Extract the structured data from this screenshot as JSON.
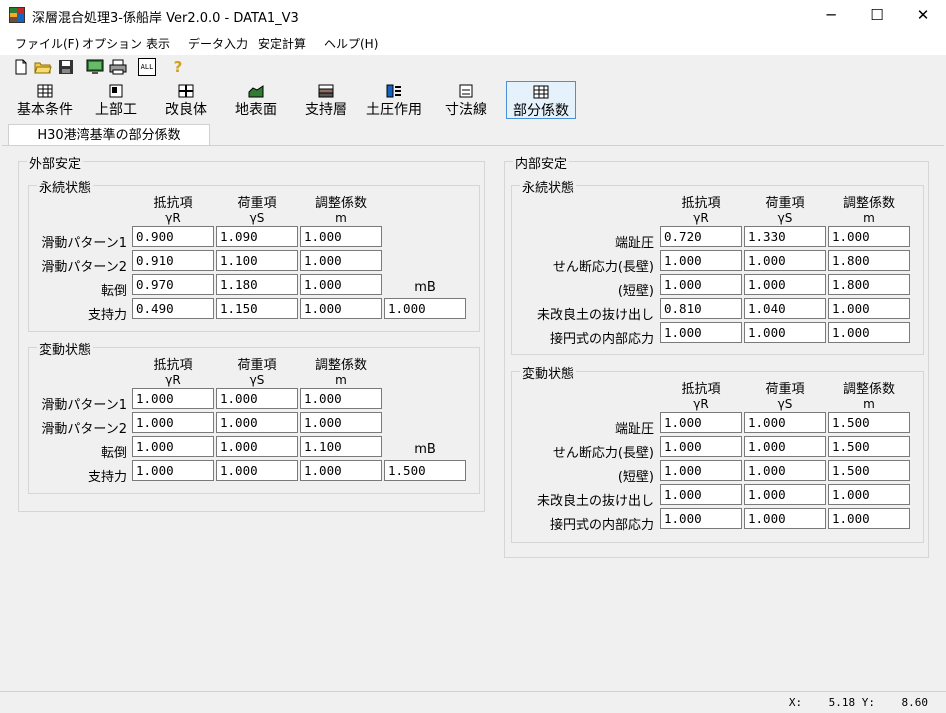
{
  "window": {
    "title": "深層混合処理3-係船岸 Ver2.0.0 - DATA1_V3",
    "minimize": "─",
    "maximize": "☐",
    "close": "✕"
  },
  "menu": [
    "ファイル(F)",
    "オプション",
    "表示",
    "データ入力",
    "安定計算",
    "ヘルプ(H)"
  ],
  "toolbar_icons": [
    "new-file-icon",
    "open-folder-icon",
    "save-icon",
    "monitor-icon",
    "print-icon",
    "all-icon",
    "help-icon"
  ],
  "toolbar_all_label": "ALL",
  "toolbar_help_glyph": "?",
  "nav_buttons": [
    {
      "label": "基本条件"
    },
    {
      "label": "上部工"
    },
    {
      "label": "改良体"
    },
    {
      "label": "地表面"
    },
    {
      "label": "支持層"
    },
    {
      "label": "土圧作用"
    },
    {
      "label": "寸法線"
    },
    {
      "label": "部分係数"
    }
  ],
  "tab": "H30港湾基準の部分係数",
  "external": {
    "title": "外部安定",
    "headers": [
      {
        "title": "抵抗項",
        "sub": "γR"
      },
      {
        "title": "荷重項",
        "sub": "γS"
      },
      {
        "title": "調整係数",
        "sub": "m"
      }
    ],
    "mb_label": "mB",
    "permanent": {
      "title": "永続状態",
      "rows": [
        {
          "label": "滑動パターン1",
          "values": [
            "0.900",
            "1.090",
            "1.000"
          ]
        },
        {
          "label": "滑動パターン2",
          "values": [
            "0.910",
            "1.100",
            "1.000"
          ]
        },
        {
          "label": "転倒",
          "values": [
            "0.970",
            "1.180",
            "1.000"
          ]
        },
        {
          "label": "支持力",
          "values": [
            "0.490",
            "1.150",
            "1.000"
          ],
          "mb": "1.000"
        }
      ]
    },
    "variable": {
      "title": "変動状態",
      "rows": [
        {
          "label": "滑動パターン1",
          "values": [
            "1.000",
            "1.000",
            "1.000"
          ]
        },
        {
          "label": "滑動パターン2",
          "values": [
            "1.000",
            "1.000",
            "1.000"
          ]
        },
        {
          "label": "転倒",
          "values": [
            "1.000",
            "1.000",
            "1.100"
          ]
        },
        {
          "label": "支持力",
          "values": [
            "1.000",
            "1.000",
            "1.000"
          ],
          "mb": "1.500"
        }
      ]
    }
  },
  "internal": {
    "title": "内部安定",
    "headers": [
      {
        "title": "抵抗項",
        "sub": "γR"
      },
      {
        "title": "荷重項",
        "sub": "γS"
      },
      {
        "title": "調整係数",
        "sub": "m"
      }
    ],
    "permanent": {
      "title": "永続状態",
      "rows": [
        {
          "label": "端趾圧",
          "values": [
            "0.720",
            "1.330",
            "1.000"
          ]
        },
        {
          "label": "せん断応力(長壁)",
          "values": [
            "1.000",
            "1.000",
            "1.800"
          ]
        },
        {
          "label": "(短壁)",
          "values": [
            "1.000",
            "1.000",
            "1.800"
          ]
        },
        {
          "label": "未改良土の抜け出し",
          "values": [
            "0.810",
            "1.040",
            "1.000"
          ]
        },
        {
          "label": "接円式の内部応力",
          "values": [
            "1.000",
            "1.000",
            "1.000"
          ]
        }
      ]
    },
    "variable": {
      "title": "変動状態",
      "rows": [
        {
          "label": "端趾圧",
          "values": [
            "1.000",
            "1.000",
            "1.500"
          ]
        },
        {
          "label": "せん断応力(長壁)",
          "values": [
            "1.000",
            "1.000",
            "1.500"
          ]
        },
        {
          "label": "(短壁)",
          "values": [
            "1.000",
            "1.000",
            "1.500"
          ]
        },
        {
          "label": "未改良土の抜け出し",
          "values": [
            "1.000",
            "1.000",
            "1.000"
          ]
        },
        {
          "label": "接円式の内部応力",
          "values": [
            "1.000",
            "1.000",
            "1.000"
          ]
        }
      ]
    }
  },
  "status": {
    "x_label": "X:",
    "x": "5.18",
    "y_label": "Y:",
    "y": "8.60"
  },
  "colors": {
    "accent": "#4a90d9",
    "window_bg": "#f0f0f0",
    "field_border": "#7a7a7a"
  }
}
